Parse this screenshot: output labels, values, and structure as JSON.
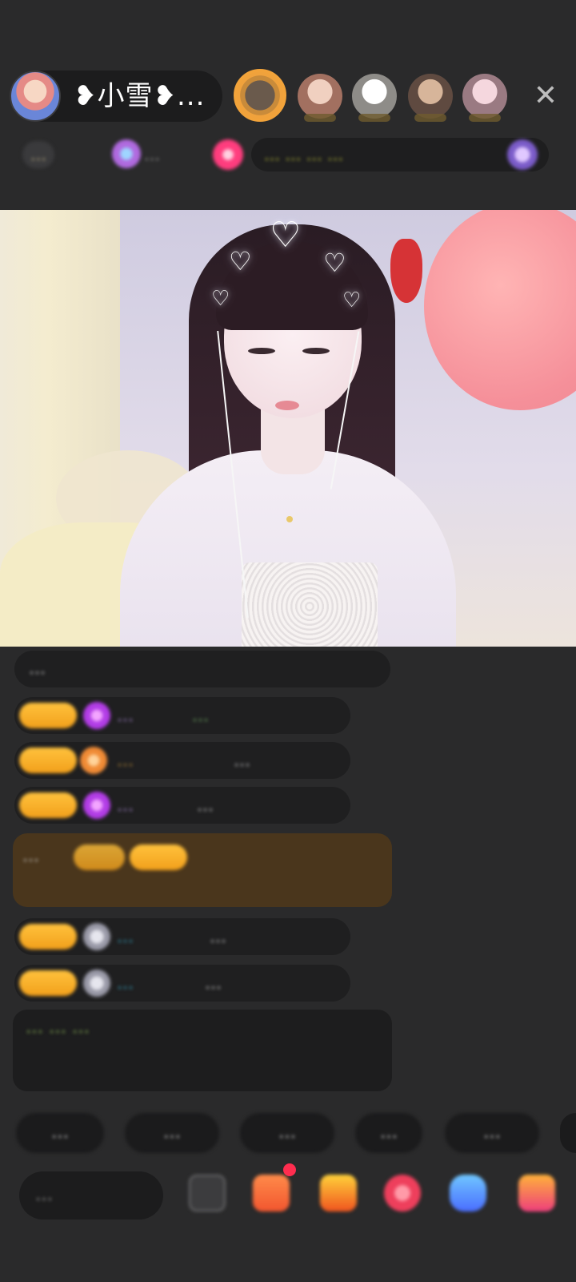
{
  "header": {
    "host_name": "❥小雪❥...",
    "close_label": "✕",
    "info_rank": "…",
    "info_stat": "…",
    "task_text": "… … … …"
  },
  "chat": {
    "rows": [
      {
        "text": "…"
      },
      {
        "badge": "…",
        "user": "…",
        "msg": "…"
      },
      {
        "badge": "…",
        "user": "…",
        "msg": "…"
      },
      {
        "badge": "…",
        "user": "…",
        "msg": "…"
      },
      {
        "notice": "…"
      },
      {
        "badge": "…",
        "user": "…",
        "msg": "…"
      },
      {
        "badge": "…",
        "user": "…",
        "msg": "…"
      }
    ],
    "system_text": "… … …"
  },
  "quick_replies": [
    "…",
    "…",
    "…",
    "…",
    "…"
  ],
  "bottom": {
    "input_placeholder": "…"
  },
  "colors": {
    "background": "#2a2a2b",
    "badge_gold": "#f2a01b",
    "system_green": "#96c35a"
  }
}
